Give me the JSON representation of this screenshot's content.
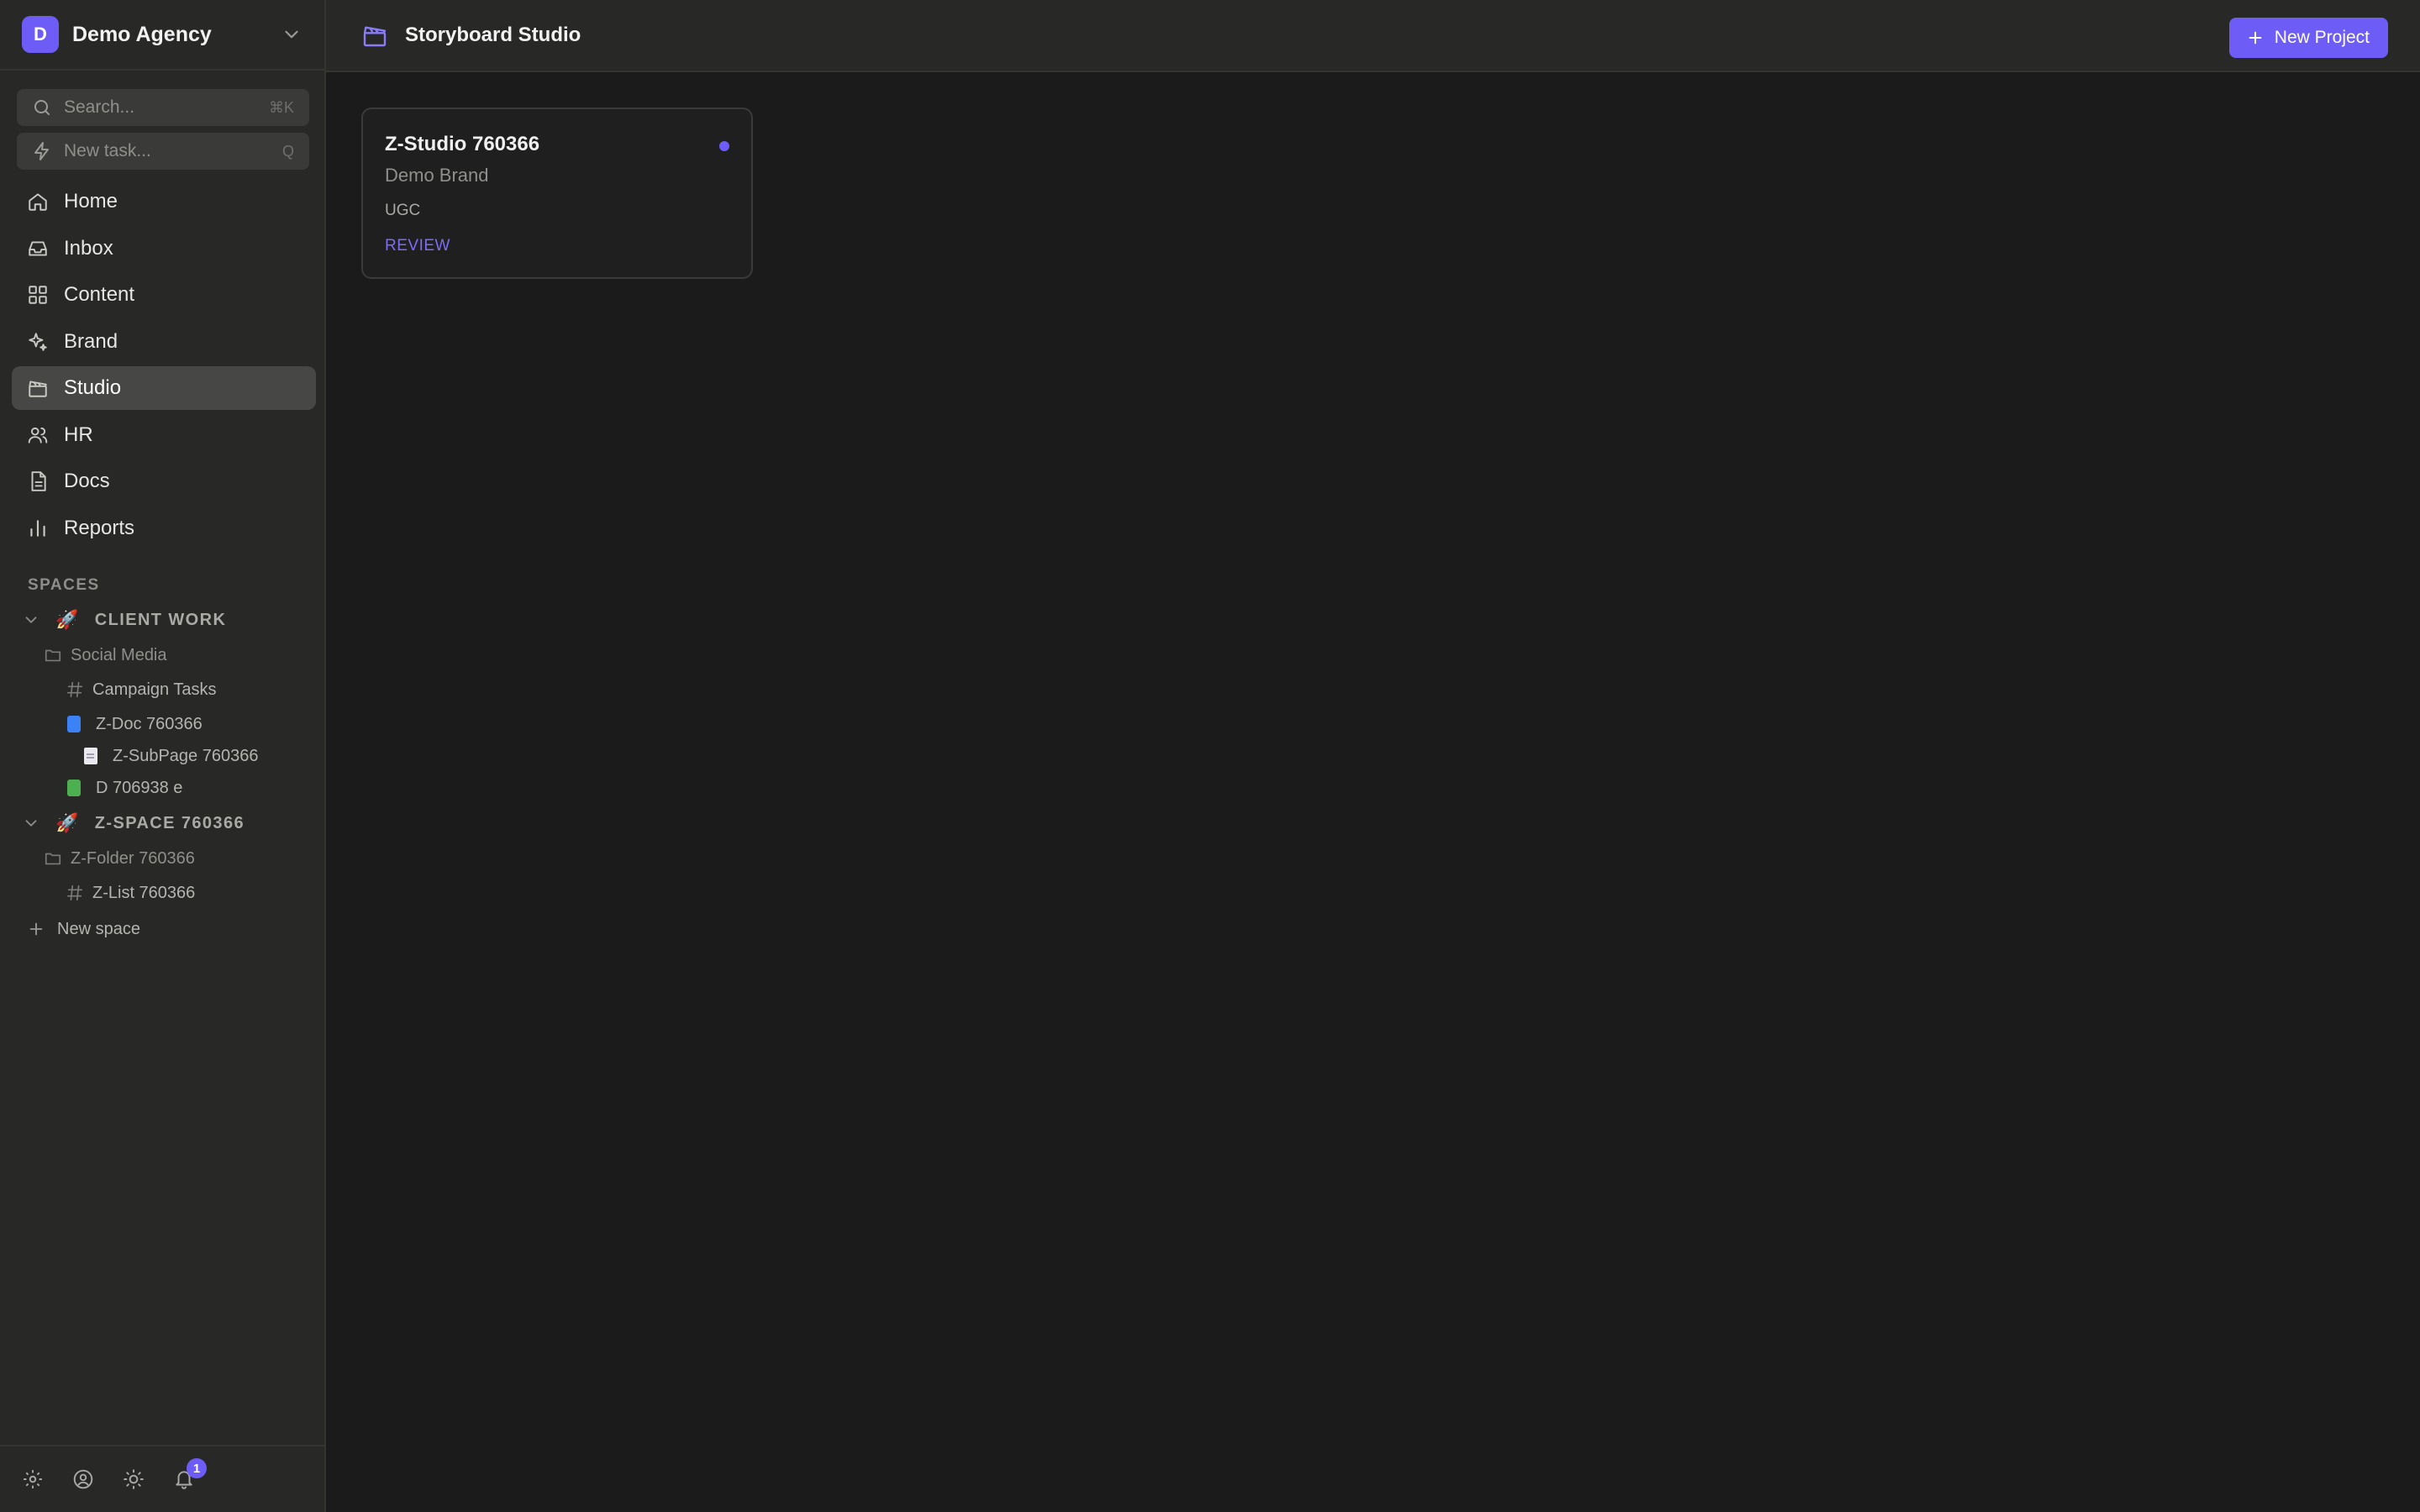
{
  "workspace": {
    "initial": "D",
    "name": "Demo Agency"
  },
  "search": {
    "placeholder": "Search...",
    "shortcut": "⌘K"
  },
  "new_task": {
    "label": "New task...",
    "shortcut": "Q"
  },
  "nav": {
    "items": [
      {
        "label": "Home",
        "icon": "home-icon"
      },
      {
        "label": "Inbox",
        "icon": "inbox-icon"
      },
      {
        "label": "Content",
        "icon": "grid-icon"
      },
      {
        "label": "Brand",
        "icon": "sparkle-icon"
      },
      {
        "label": "Studio",
        "icon": "clapperboard-icon",
        "active": true
      },
      {
        "label": "HR",
        "icon": "users-icon"
      },
      {
        "label": "Docs",
        "icon": "document-icon"
      },
      {
        "label": "Reports",
        "icon": "bar-chart-icon"
      }
    ]
  },
  "spaces": {
    "heading": "SPACES",
    "client_work": {
      "emoji": "🚀",
      "name": "CLIENT WORK",
      "folder": "Social Media",
      "list": "Campaign Tasks",
      "doc": "Z-Doc 760366",
      "doc_color": "#3b82f6",
      "subpage": "Z-SubPage 760366",
      "doc2": "D 706938 e",
      "doc2_color": "#4caf50"
    },
    "z_space": {
      "emoji": "🚀",
      "name": "Z-SPACE 760366",
      "folder": "Z-Folder 760366",
      "list": "Z-List 760366"
    },
    "new_space": "New space"
  },
  "footer": {
    "notification_count": "1"
  },
  "header": {
    "title": "Storyboard Studio",
    "new_project": "New Project"
  },
  "project_card": {
    "title": "Z-Studio 760366",
    "brand": "Demo Brand",
    "type": "UGC",
    "status": "REVIEW",
    "status_color": "#7c6cf7"
  },
  "colors": {
    "accent": "#6e5cf6",
    "background": "#1b1b1b",
    "sidebar": "#282826"
  }
}
